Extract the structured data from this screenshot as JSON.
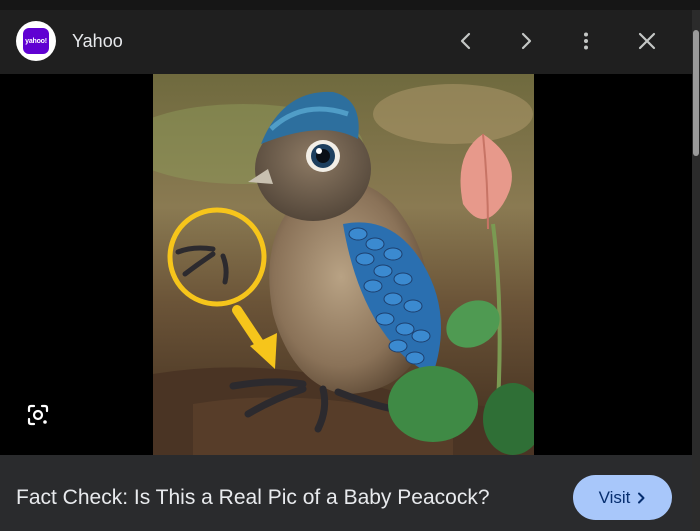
{
  "header": {
    "source_logo_text": "yahoo!",
    "source_name": "Yahoo",
    "prev_icon": "chevron-left-icon",
    "next_icon": "chevron-right-icon",
    "more_icon": "more-vert-icon",
    "close_icon": "close-icon"
  },
  "image": {
    "subject": "baby peacock illustration",
    "lens_icon": "google-lens-icon",
    "colors": {
      "highlight_circle": "#f6c51b",
      "arrow": "#f6c51b"
    }
  },
  "footer": {
    "title": "Fact Check: Is This a Real Pic of a Baby Peacock?",
    "visit_label": "Visit",
    "visit_icon": "chevron-right-icon"
  },
  "colors": {
    "background": "#1f1f1f",
    "footer_bg": "#2a2b2d",
    "accent_button": "#a8c7fa",
    "brand": "#6001d2"
  }
}
